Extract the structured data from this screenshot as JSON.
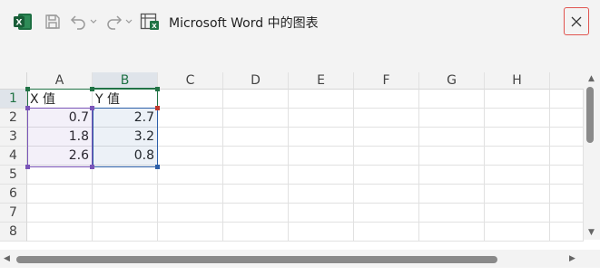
{
  "window": {
    "title": "Microsoft Word 中的图表"
  },
  "toolbar": {
    "icons": [
      "excel-icon",
      "save-icon",
      "undo-icon",
      "redo-icon",
      "chart-data-icon"
    ],
    "colors": {
      "excel_green": "#217346",
      "close_border": "#e0544f"
    }
  },
  "sheet": {
    "columns": [
      "A",
      "B",
      "C",
      "D",
      "E",
      "F",
      "G",
      "H"
    ],
    "rows": [
      "1",
      "2",
      "3",
      "4",
      "5",
      "6",
      "7",
      "8"
    ],
    "cells": {
      "A1": "X 值",
      "B1": "Y 值",
      "A2": "0.7",
      "B2": "2.7",
      "A3": "1.8",
      "B3": "3.2",
      "A4": "2.6",
      "B4": "0.8"
    },
    "selected_column": "B",
    "selected_row": "1",
    "range_colors": {
      "x_series": "#7a55b8",
      "y_series": "#2d5fa8",
      "header": "#217346"
    }
  }
}
